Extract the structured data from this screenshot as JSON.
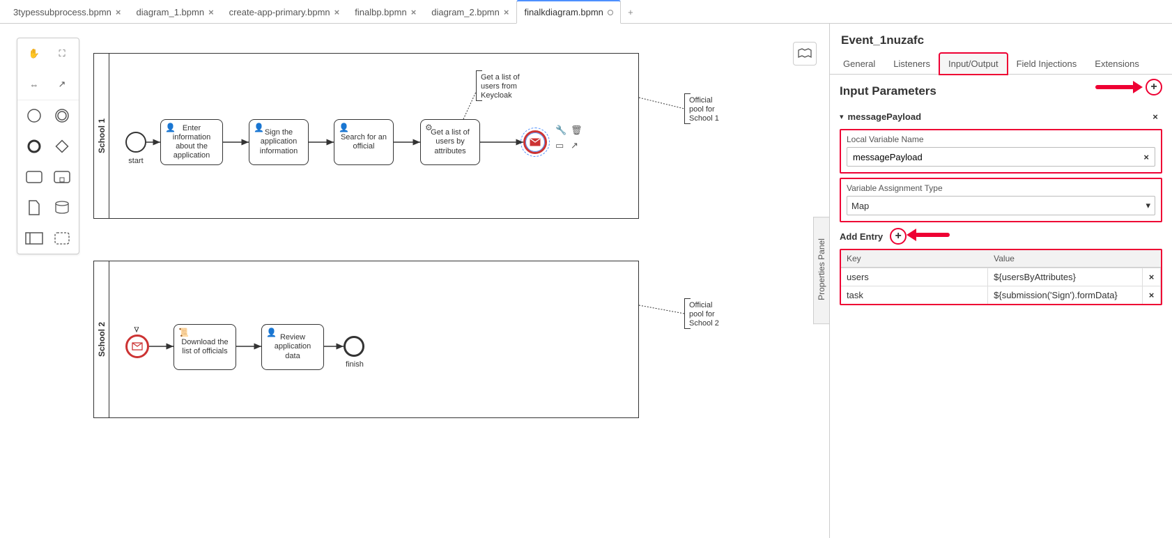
{
  "tabs": [
    {
      "label": "3typessubprocess.bpmn",
      "dirty": false
    },
    {
      "label": "diagram_1.bpmn",
      "dirty": false
    },
    {
      "label": "create-app-primary.bpmn",
      "dirty": false
    },
    {
      "label": "finalbp.bpmn",
      "dirty": false
    },
    {
      "label": "diagram_2.bpmn",
      "dirty": false
    },
    {
      "label": "finalkdiagram.bpmn",
      "dirty": true
    }
  ],
  "activeTab": 5,
  "addTab": "+",
  "lanes": {
    "school1": "School 1",
    "school2": "School 2"
  },
  "nodes": {
    "start": "start",
    "t1": "Enter information about the application",
    "t2": "Sign the application information",
    "t3": "Search for an official",
    "t4": "Get a list of users by attributes",
    "a1": "Get a list of users from Keycloak",
    "pool1": "Official pool for School 1",
    "t5": "Download the list of officials",
    "t6": "Review application data",
    "finish": "finish",
    "pool2": "Official pool for School 2"
  },
  "panelToggle": "Properties Panel",
  "props": {
    "title": "Event_1nuzafc",
    "tabs": [
      "General",
      "Listeners",
      "Input/Output",
      "Field Injections",
      "Extensions"
    ],
    "activeTab": 2,
    "sectionTitle": "Input Parameters",
    "paramName": "messagePayload",
    "localVarLabel": "Local Variable Name",
    "localVarValue": "messagePayload",
    "assignTypeLabel": "Variable Assignment Type",
    "assignTypeValue": "Map",
    "addEntry": "Add Entry",
    "kvHead": {
      "k": "Key",
      "v": "Value"
    },
    "entries": [
      {
        "k": "users",
        "v": "${usersByAttributes}"
      },
      {
        "k": "task",
        "v": "${submission('Sign').formData}"
      }
    ]
  }
}
